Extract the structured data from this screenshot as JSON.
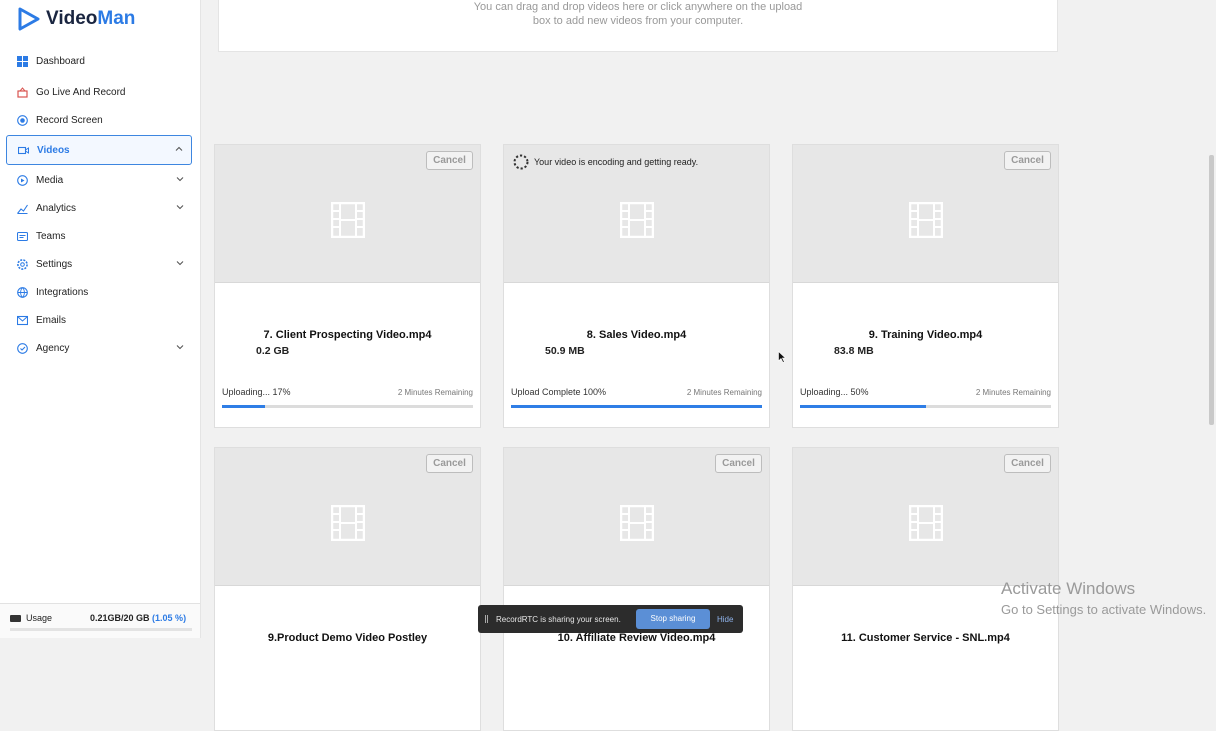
{
  "app": {
    "logo_text_a": "Video",
    "logo_text_b": "Man"
  },
  "sidebar": {
    "items": [
      {
        "label": "Dashboard",
        "icon": "grid-icon",
        "expandable": false
      },
      {
        "label": "Go Live And Record",
        "icon": "live-icon",
        "expandable": false
      },
      {
        "label": "Record Screen",
        "icon": "record-icon",
        "expandable": false
      },
      {
        "label": "Videos",
        "icon": "video-icon",
        "expandable": true,
        "active": true
      },
      {
        "label": "Media",
        "icon": "media-icon",
        "expandable": true
      },
      {
        "label": "Analytics",
        "icon": "analytics-icon",
        "expandable": true
      },
      {
        "label": "Teams",
        "icon": "teams-icon",
        "expandable": false
      },
      {
        "label": "Settings",
        "icon": "gear-icon",
        "expandable": true
      },
      {
        "label": "Integrations",
        "icon": "integrations-icon",
        "expandable": false
      },
      {
        "label": "Emails",
        "icon": "email-icon",
        "expandable": false
      },
      {
        "label": "Agency",
        "icon": "agency-icon",
        "expandable": true
      }
    ],
    "usage": {
      "label": "Usage",
      "value": "0.21GB/20 GB",
      "percent": "(1.05 %)",
      "fraction": 0.0105
    }
  },
  "dropzone": {
    "line1": "You can drag and drop videos here or click anywhere on the upload",
    "line2": "box to add new videos from your computer."
  },
  "cards": [
    {
      "name": "7. Client Prospecting Video.mp4",
      "size": "0.2 GB",
      "status": "Uploading... 17%",
      "remaining": "2 Minutes Remaining",
      "progress": 0.17,
      "cancel": "Cancel"
    },
    {
      "name": "8. Sales Video.mp4",
      "size": "50.9 MB",
      "status": "Upload Complete 100%",
      "remaining": "2 Minutes Remaining",
      "progress": 1.0,
      "encoding": "Your video is encoding and getting ready."
    },
    {
      "name": "9. Training Video.mp4",
      "size": "83.8 MB",
      "status": "Uploading... 50%",
      "remaining": "2 Minutes Remaining",
      "progress": 0.5,
      "cancel": "Cancel"
    },
    {
      "name": "9.Product Demo Video Postley",
      "cancel": "Cancel"
    },
    {
      "name": "10. Affiliate Review Video.mp4",
      "cancel": "Cancel"
    },
    {
      "name": "11. Customer Service - SNL.mp4",
      "cancel": "Cancel"
    }
  ],
  "sharebar": {
    "message": "RecordRTC is sharing your screen.",
    "stop_label": "Stop sharing",
    "hide_label": "Hide"
  },
  "watermark": {
    "line1": "Activate Windows",
    "line2": "Go to Settings to activate Windows."
  },
  "colors": {
    "accent": "#2c7be5",
    "progress": "#2f7ee6"
  }
}
